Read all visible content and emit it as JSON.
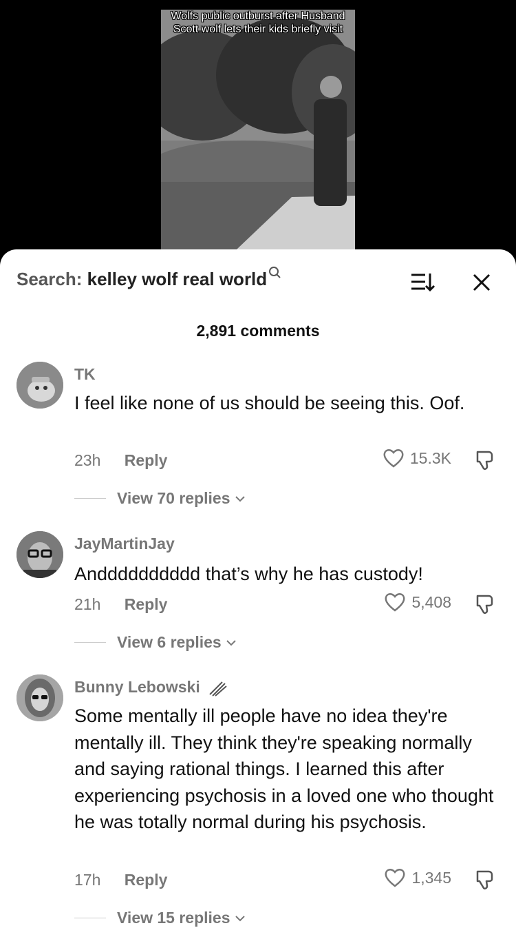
{
  "video": {
    "caption": "Wolfs public outburst after Husband Scott wolf lets their kids briefly visit"
  },
  "search": {
    "prefix": "Search:",
    "query": "kelley wolf real world"
  },
  "comments_count": "2,891 comments",
  "comments": [
    {
      "username": "TK",
      "text": "I feel like none of us should be seeing this. Oof.",
      "time": "23h",
      "reply": "Reply",
      "likes": "15.3K",
      "view_replies": "View 70 replies"
    },
    {
      "username": "JayMartinJay",
      "text": "Andddddddddd that’s why he has custody!",
      "time": "21h",
      "reply": "Reply",
      "likes": "5,408",
      "view_replies": "View 6 replies"
    },
    {
      "username": "Bunny Lebowski",
      "text": "Some mentally ill people have no idea they're mentally ill. They think they're speaking normally and saying rational things. I learned this after experiencing psychosis in a loved one who thought he was totally normal during his psychosis.",
      "time": "17h",
      "reply": "Reply",
      "likes": "1,345",
      "view_replies": "View 15 replies"
    }
  ],
  "icons": {
    "search": "magnifier-icon",
    "sort": "sort-icon",
    "close": "close-icon",
    "like": "heart-icon",
    "dislike": "thumbs-down-icon"
  }
}
